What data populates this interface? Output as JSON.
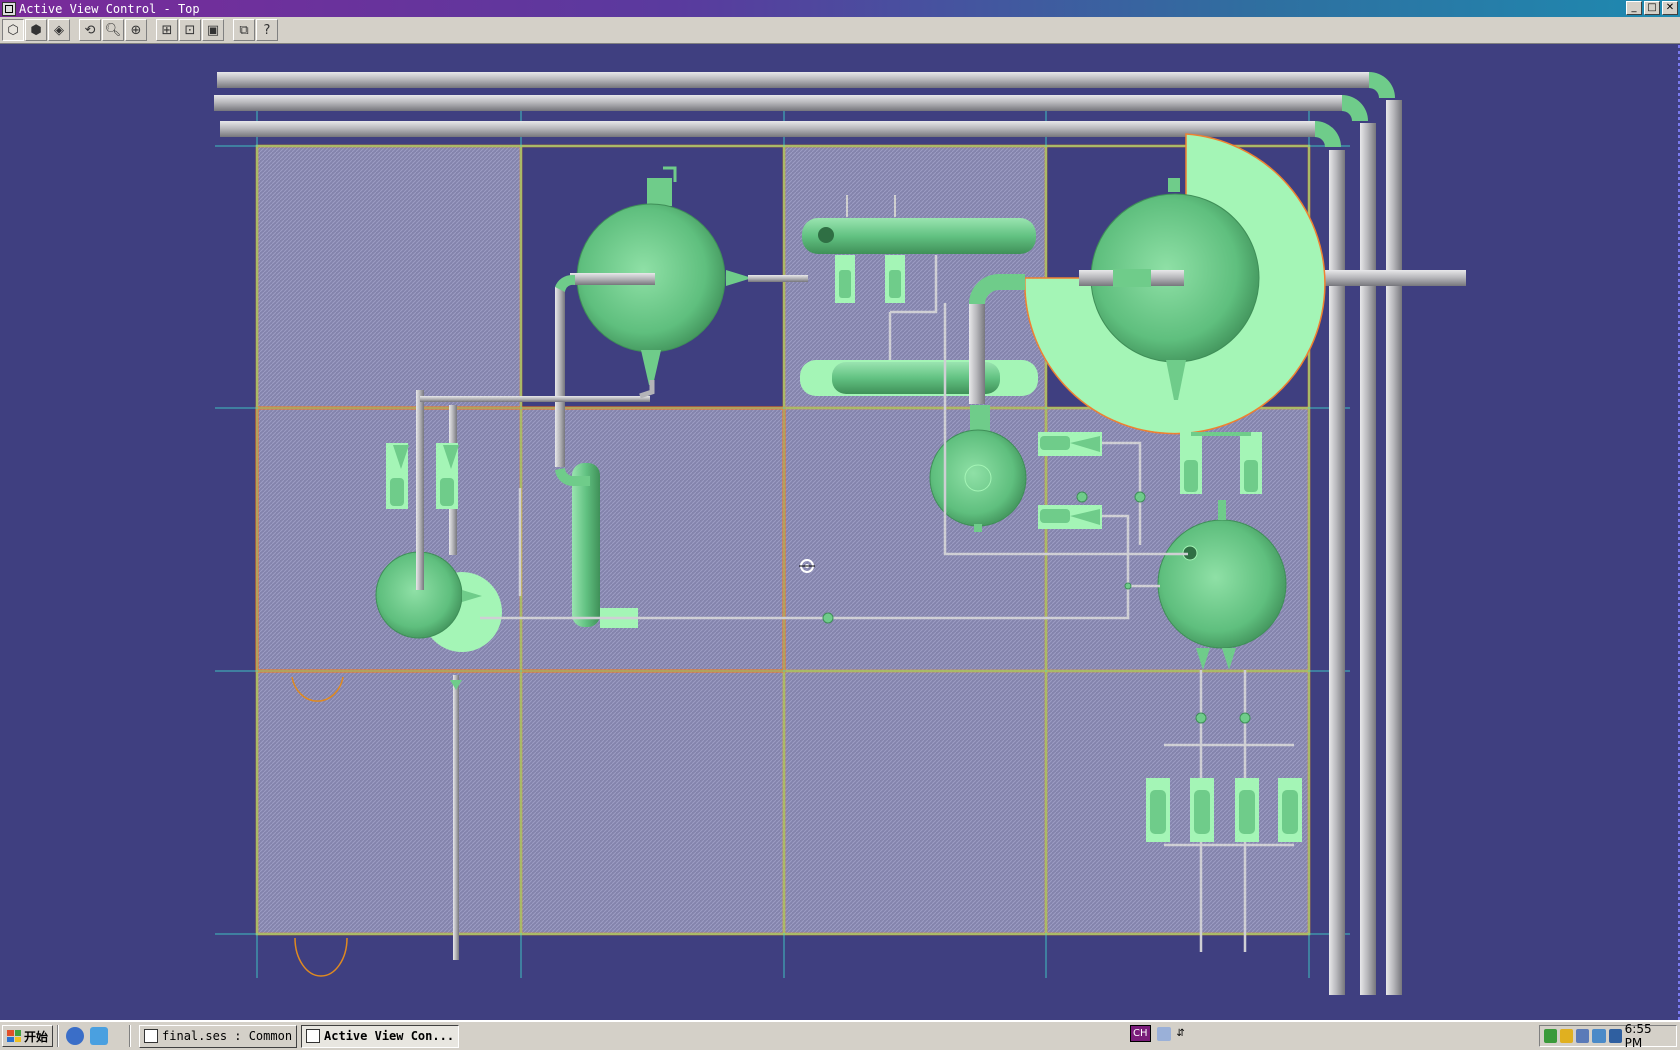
{
  "window": {
    "title": "Active View Control - Top",
    "controls": [
      "minimize",
      "maximize",
      "close"
    ]
  },
  "toolbar": {
    "groups": [
      [
        "iso-view-icon",
        "iso-view-2-icon",
        "iso-view-3-icon"
      ],
      [
        "rotate-icon",
        "zoom-icon",
        "zoom-area-icon"
      ],
      [
        "fit-all-icon",
        "fit-window-icon",
        "frame-icon"
      ],
      [
        "views-icon",
        "help-icon"
      ]
    ]
  },
  "taskbar": {
    "start_label": "开始",
    "tasks": [
      {
        "label": "final.ses : Common ...",
        "active": false
      },
      {
        "label": "Active View Con...",
        "active": true
      }
    ],
    "language": "CH",
    "clock": "6:55 PM"
  },
  "colors": {
    "background": "#3f3f80",
    "equipment": "#6fcc8a",
    "selected": "#a4f5b6",
    "grid_border": "#f0a020",
    "pipe": "#b9b9bd"
  }
}
